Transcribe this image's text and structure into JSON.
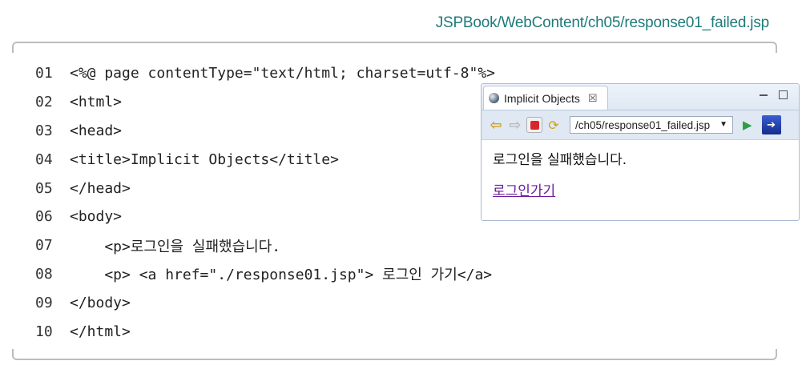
{
  "file_path": "JSPBook/WebContent/ch05/response01_failed.jsp",
  "code_lines": [
    {
      "num": "01",
      "text": "<%@ page contentType=\"text/html; charset=utf-8\"%>"
    },
    {
      "num": "02",
      "text": "<html>"
    },
    {
      "num": "03",
      "text": "<head>"
    },
    {
      "num": "04",
      "text": "<title>Implicit Objects</title>"
    },
    {
      "num": "05",
      "text": "</head>"
    },
    {
      "num": "06",
      "text": "<body>"
    },
    {
      "num": "07",
      "text": "    <p>로그인을 실패했습니다."
    },
    {
      "num": "08",
      "text": "    <p> <a href=\"./response01.jsp\"> 로그인 가기</a>"
    },
    {
      "num": "09",
      "text": "</body>"
    },
    {
      "num": "10",
      "text": "</html>"
    }
  ],
  "browser": {
    "tab_title": "Implicit Objects",
    "tab_close": "☒",
    "url": "/ch05/response01_failed.jsp",
    "message": "로그인을 실패했습니다.",
    "link_text": "로그인가기"
  },
  "colors": {
    "file_path": "#1f7a7a",
    "link": "#6a1b9a",
    "stop": "#d9262c",
    "go": "#2f9e44"
  }
}
